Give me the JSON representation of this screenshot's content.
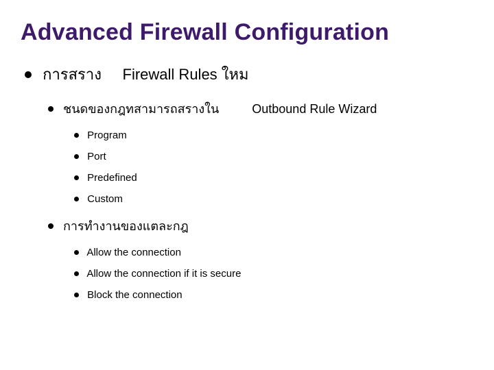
{
  "title": "Advanced Firewall Configuration",
  "level1": {
    "text_before": "การสราง",
    "text_after": "Firewall Rules ใหม"
  },
  "level2a": {
    "left": "ชนดของกฎทสามารถสรางใน",
    "right": "Outbound Rule Wizard",
    "items": [
      "Program",
      "Port",
      "Predefined",
      "Custom"
    ]
  },
  "level2b": {
    "text": "การทำงานของแตละกฎ",
    "items": [
      "Allow the connection",
      "Allow the connection if it is secure",
      "Block the connection"
    ]
  }
}
